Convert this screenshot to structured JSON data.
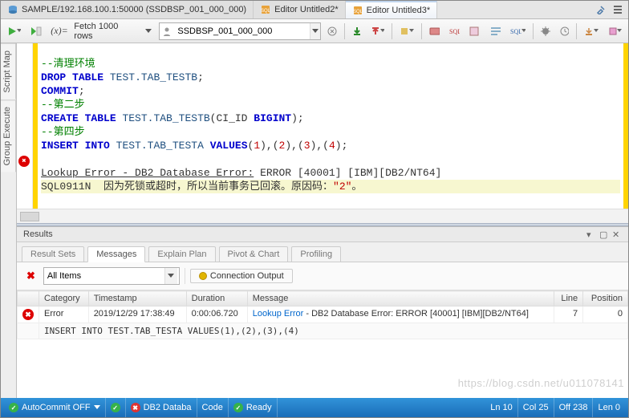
{
  "tabs": [
    {
      "label": "SAMPLE/192.168.100.1:50000 (SSDBSP_001_000_000)",
      "icon": "db-icon"
    },
    {
      "label": "Editor Untitled2*",
      "icon": "sql-icon"
    },
    {
      "label": "Editor Untitled3*",
      "icon": "sql-icon"
    }
  ],
  "toolbar": {
    "fetch_label": "Fetch 1000 rows",
    "schema_value": "SSDBSP_001_000_000"
  },
  "sidetabs": {
    "script_map": "Script Map",
    "group_execute": "Group Execute"
  },
  "code": {
    "l1": "--清理环境",
    "l2a": "DROP",
    "l2b": "TABLE",
    "l2c": "TEST.TAB_TESTB",
    "l2d": ";",
    "l3a": "COMMIT",
    "l3b": ";",
    "l4": "--第二步",
    "l5a": "CREATE",
    "l5b": "TABLE",
    "l5c": "TEST.TAB_TESTB",
    "l5d": "(CI_ID",
    "l5e": "BIGINT",
    "l5f": ");",
    "l6": "--第四步",
    "l7a": "INSERT",
    "l7b": "INTO",
    "l7c": "TEST.TAB_TESTA",
    "l7d": "VALUES",
    "l7e": "(",
    "l7n1": "1",
    "l7n2": "2",
    "l7n3": "3",
    "l7n4": "4",
    "l7c1": "),(",
    "l7c2": "),(",
    "l7c3": "),(",
    "l7f": ");",
    "err1a": "Lookup Error - DB2 Database Error:",
    "err1b": "ERROR [40001] [IBM][DB2/NT64]",
    "err2a": "SQL0911N  因为死锁或超时，所以当前事务已回滚。原因码：",
    "err2b": "\"2\"",
    "err2c": "。"
  },
  "panel": {
    "title": "Results",
    "tabs": {
      "result_sets": "Result Sets",
      "messages": "Messages",
      "explain_plan": "Explain Plan",
      "pivot_chart": "Pivot & Chart",
      "profiling": "Profiling"
    },
    "filter_value": "All Items",
    "connection_output": "Connection Output",
    "columns": {
      "category": "Category",
      "timestamp": "Timestamp",
      "duration": "Duration",
      "message": "Message",
      "line": "Line",
      "position": "Position"
    },
    "rows": [
      {
        "category": "Error",
        "timestamp": "2019/12/29 17:38:49",
        "duration": "0:00:06.720",
        "message_link": "Lookup Error",
        "message_rest": " - DB2 Database Error: ERROR [40001] [IBM][DB2/NT64]",
        "line": "7",
        "position": "0",
        "detail": "INSERT INTO TEST.TAB_TESTA VALUES(1),(2),(3),(4)"
      }
    ]
  },
  "status": {
    "autocommit": "AutoCommit OFF",
    "db": "DB2 Databa",
    "code": "Code",
    "ready": "Ready",
    "ln": "Ln 10",
    "col": "Col 25",
    "off": "Off 238",
    "len": "Len 0"
  },
  "watermark": "https://blog.csdn.net/u011078141"
}
